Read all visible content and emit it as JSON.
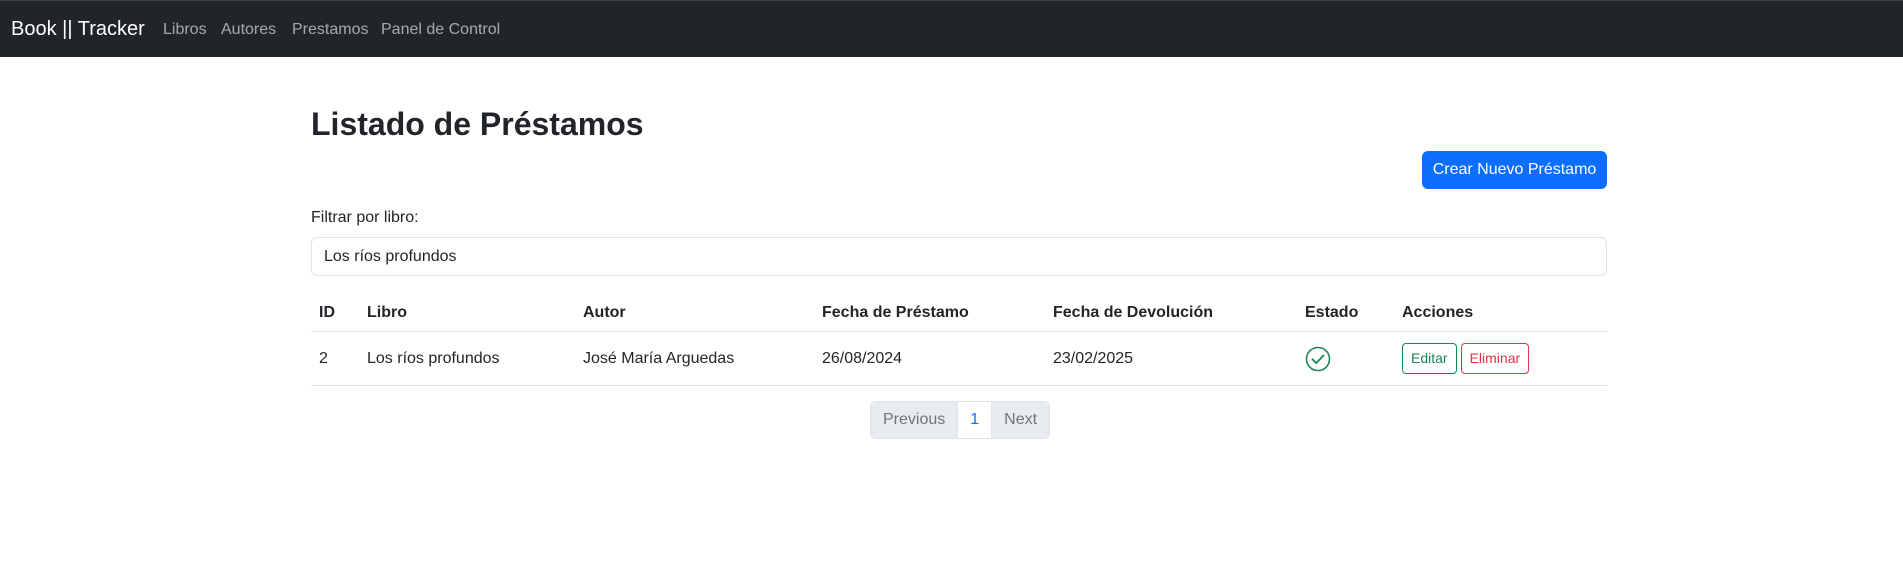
{
  "navbar": {
    "brand": "Book || Tracker",
    "links": [
      "Libros",
      "Autores",
      "Prestamos",
      "Panel de Control"
    ]
  },
  "page": {
    "title": "Listado de Préstamos",
    "create_button": "Crear Nuevo Préstamo"
  },
  "filter": {
    "label": "Filtrar por libro:",
    "value": "Los ríos profundos"
  },
  "table": {
    "headers": [
      "ID",
      "Libro",
      "Autor",
      "Fecha de Préstamo",
      "Fecha de Devolución",
      "Estado",
      "Acciones"
    ],
    "rows": [
      {
        "id": "2",
        "libro": "Los ríos profundos",
        "autor": "José María Arguedas",
        "fecha_prestamo": "26/08/2024",
        "fecha_devolucion": "23/02/2025",
        "estado_icon": "check-circle-icon",
        "edit_label": "Editar",
        "delete_label": "Eliminar"
      }
    ]
  },
  "pagination": {
    "previous": "Previous",
    "current": "1",
    "next": "Next"
  },
  "colors": {
    "navbar_bg": "#212529",
    "primary": "#0d6efd",
    "success": "#198754",
    "danger": "#dc3545"
  }
}
